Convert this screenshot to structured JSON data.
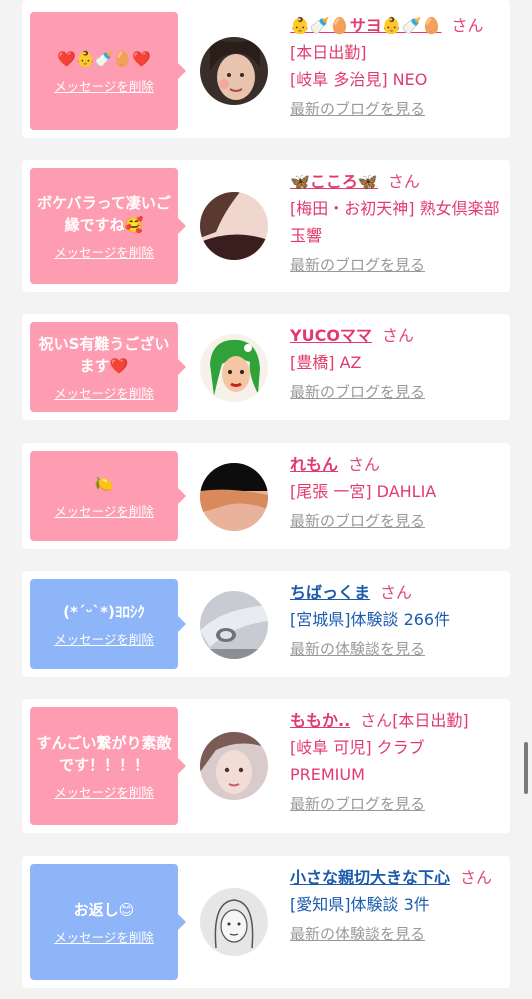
{
  "cards": [
    {
      "bubble_color": "pink",
      "message": "❤️👶🍼🥚❤️",
      "delete_label": "メッセージを削除",
      "name": "👶🍼🥚サヨ👶🍼🥚",
      "honorific": "さん",
      "extra": "[本日出勤]",
      "location": "[岐阜 多治見] NEO",
      "link": "最新のブログを見る"
    },
    {
      "bubble_color": "pink",
      "message": "ボケバラって凄いご縁ですね🥰",
      "delete_label": "メッセージを削除",
      "name": "🦋こころ🦋",
      "honorific": "さん",
      "extra": "",
      "location": "[梅田・お初天神] 熟女倶楽部 玉響",
      "link": "最新のブログを見る"
    },
    {
      "bubble_color": "pink",
      "message": "祝いS有難うございます❤️",
      "delete_label": "メッセージを削除",
      "name": "YUCOママ",
      "honorific": "さん",
      "extra": "",
      "location": "[豊橋] AZ",
      "link": "最新のブログを見る"
    },
    {
      "bubble_color": "pink",
      "message": "🍋",
      "delete_label": "メッセージを削除",
      "name": "れもん",
      "honorific": "さん",
      "extra": "",
      "location": "[尾張 一宮] DAHLIA",
      "link": "最新のブログを見る"
    },
    {
      "bubble_color": "blue",
      "message": "(*´ᵕ`*)ﾖﾛｼｸ",
      "delete_label": "メッセージを削除",
      "name": "ちばっくま",
      "honorific": "さん",
      "extra": "",
      "location": "[宮城県]体験談 266件",
      "link": "最新の体験談を見る"
    },
    {
      "bubble_color": "pink",
      "message": "すんごい繋がり素敵です！！！！",
      "delete_label": "メッセージを削除",
      "name": "ももか..",
      "honorific": "さん",
      "extra": "[本日出勤]",
      "location": "[岐阜 可児] クラブ PREMIUM",
      "link": "最新のブログを見る"
    },
    {
      "bubble_color": "blue",
      "message": "お返し😊",
      "delete_label": "メッセージを削除",
      "name": "小さな親切大きな下心",
      "honorific": "さん",
      "extra": "",
      "location": "[愛知県]体験談 3件",
      "link": "最新の体験談を見る"
    }
  ],
  "colors": {
    "pink_bubble": "#fe9cb1",
    "blue_bubble": "#8db5f8",
    "pink_text": "#e23a6c",
    "blue_text": "#1b5bac",
    "link_grey": "#999999"
  }
}
